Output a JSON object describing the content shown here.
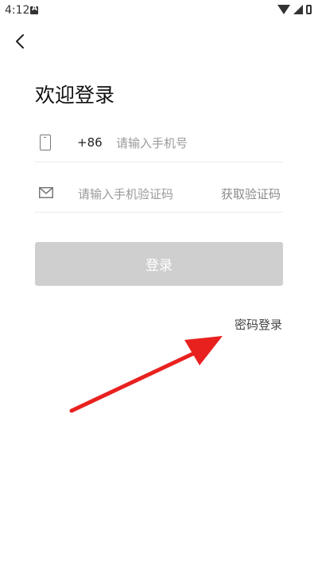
{
  "status_bar": {
    "time": "4:12",
    "left_icon": "notification-a-icon",
    "right_icons": [
      "wifi-icon",
      "signal-icon",
      "battery-icon"
    ]
  },
  "nav": {
    "back_icon": "chevron-left-icon"
  },
  "page": {
    "title": "欢迎登录"
  },
  "phone_field": {
    "icon": "phone-icon",
    "country_code": "+86",
    "placeholder": "请输入手机号",
    "value": ""
  },
  "code_field": {
    "icon": "mail-icon",
    "placeholder": "请输入手机验证码",
    "value": "",
    "get_code_label": "获取验证码"
  },
  "login_button": {
    "label": "登录",
    "enabled": false,
    "color": "#cfcfcf"
  },
  "password_login": {
    "label": "密码登录"
  },
  "annotation": {
    "type": "red-arrow",
    "color": "#e8211f"
  }
}
